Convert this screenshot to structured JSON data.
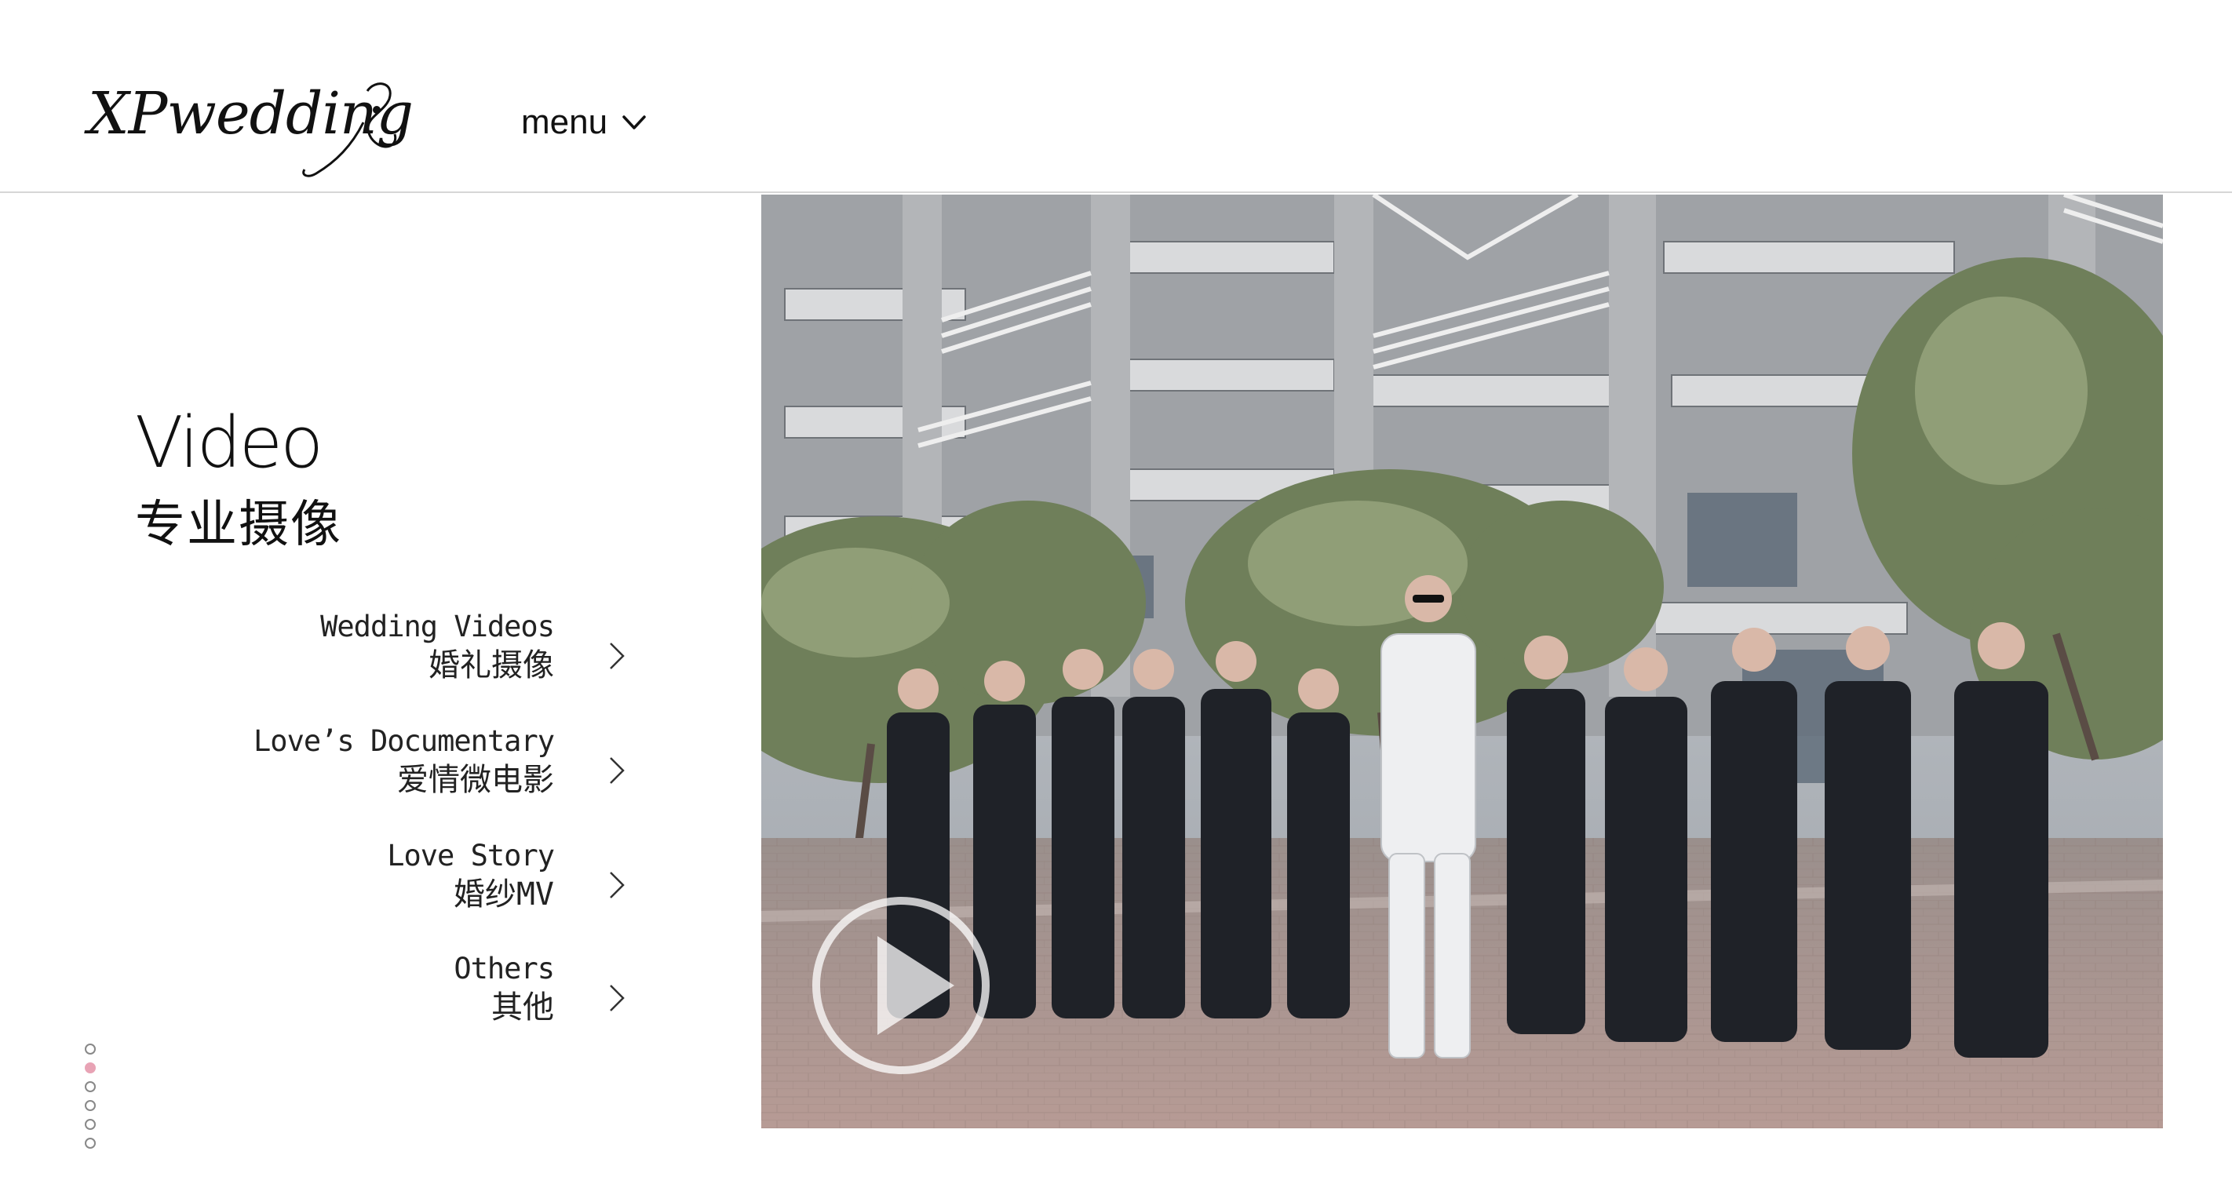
{
  "header": {
    "logo_text": "XPwedding",
    "menu_label": "menu"
  },
  "section": {
    "title": "Video",
    "subtitle": "专业摄像"
  },
  "categories": [
    {
      "en": "Wedding Videos",
      "zh": "婚礼摄像"
    },
    {
      "en": "Love’s Documentary",
      "zh": "爱情微电影"
    },
    {
      "en": "Love Story",
      "zh": "婚纱MV"
    },
    {
      "en": "Others",
      "zh": "其他"
    }
  ],
  "pager": {
    "count": 6,
    "active": 2
  },
  "icons": {
    "menu": "chevron-down-icon",
    "category": "chevron-right-icon",
    "hero": "play-icon"
  },
  "colors": {
    "accent_dot": "#e8a3b5",
    "divider": "#d6d6d6"
  }
}
